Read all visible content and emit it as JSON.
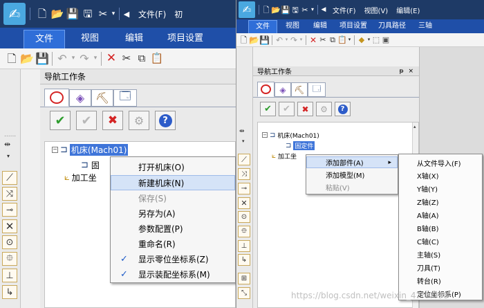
{
  "left": {
    "menu_tabs": [
      {
        "label": "文件",
        "active": true
      },
      {
        "label": "视图",
        "active": false
      },
      {
        "label": "编辑",
        "active": false
      },
      {
        "label": "项目设置",
        "active": false
      }
    ],
    "title_menu": [
      "文件(F)",
      "初"
    ],
    "panel_title": "导航工作条",
    "tree": {
      "root_label": "机床(Mach01)",
      "child_label": "固",
      "process_label": "加工坐"
    },
    "context_menu": [
      {
        "label": "打开机床(O)",
        "checked": false,
        "disabled": false,
        "hover": false
      },
      {
        "label": "新建机床(N)",
        "checked": false,
        "disabled": false,
        "hover": true
      },
      {
        "label": "保存(S)",
        "checked": false,
        "disabled": true,
        "hover": false
      },
      {
        "label": "另存为(A)",
        "checked": false,
        "disabled": false,
        "hover": false
      },
      {
        "label": "参数配置(P)",
        "checked": false,
        "disabled": false,
        "hover": false
      },
      {
        "label": "重命名(R)",
        "checked": false,
        "disabled": false,
        "hover": false
      },
      {
        "label": "显示零位坐标系(Z)",
        "checked": true,
        "disabled": false,
        "hover": false
      },
      {
        "label": "显示装配坐标系(M)",
        "checked": true,
        "disabled": false,
        "hover": false
      }
    ]
  },
  "right": {
    "menu_tabs": [
      {
        "label": "文件",
        "active": true
      },
      {
        "label": "视图",
        "active": false
      },
      {
        "label": "编辑",
        "active": false
      },
      {
        "label": "项目设置",
        "active": false
      },
      {
        "label": "刀具路径",
        "active": false
      },
      {
        "label": "三轴",
        "active": false
      }
    ],
    "title_menu": [
      "文件(F)",
      "视图(V)",
      "编辑(E)"
    ],
    "panel_title": "导航工作条",
    "panel_controls": "ᵽ ×",
    "tree": {
      "root_label": "机床(Mach01)",
      "child_label": "固定件",
      "process_label": "加工坐"
    },
    "context_menu": [
      {
        "label": "添加部件(A)",
        "arrow": "▸",
        "disabled": false,
        "hover": true
      },
      {
        "label": "添加模型(M)",
        "arrow": "",
        "disabled": false,
        "hover": false
      },
      {
        "label": "粘贴(V)",
        "arrow": "",
        "disabled": true,
        "hover": false
      }
    ],
    "submenu": [
      "从文件导入(F)",
      "X轴(X)",
      "Y轴(Y)",
      "Z轴(Z)",
      "A轴(A)",
      "B轴(B)",
      "C轴(C)",
      "主轴(S)",
      "刀具(T)",
      "转台(R)",
      "定位坐标系(P)"
    ],
    "watermark": "https://blog.csdn.net/weixin_4?????98"
  },
  "icons": {
    "check": "✔",
    "xmark": "✖",
    "gear": "⚙",
    "help": "?",
    "arrow": "▸"
  },
  "colors": {
    "menubar": "#1f4fa8",
    "titlebar": "#1e3a66",
    "highlight": "#3f75d9",
    "check_green": "#2e9d2e",
    "x_red": "#d42424"
  }
}
